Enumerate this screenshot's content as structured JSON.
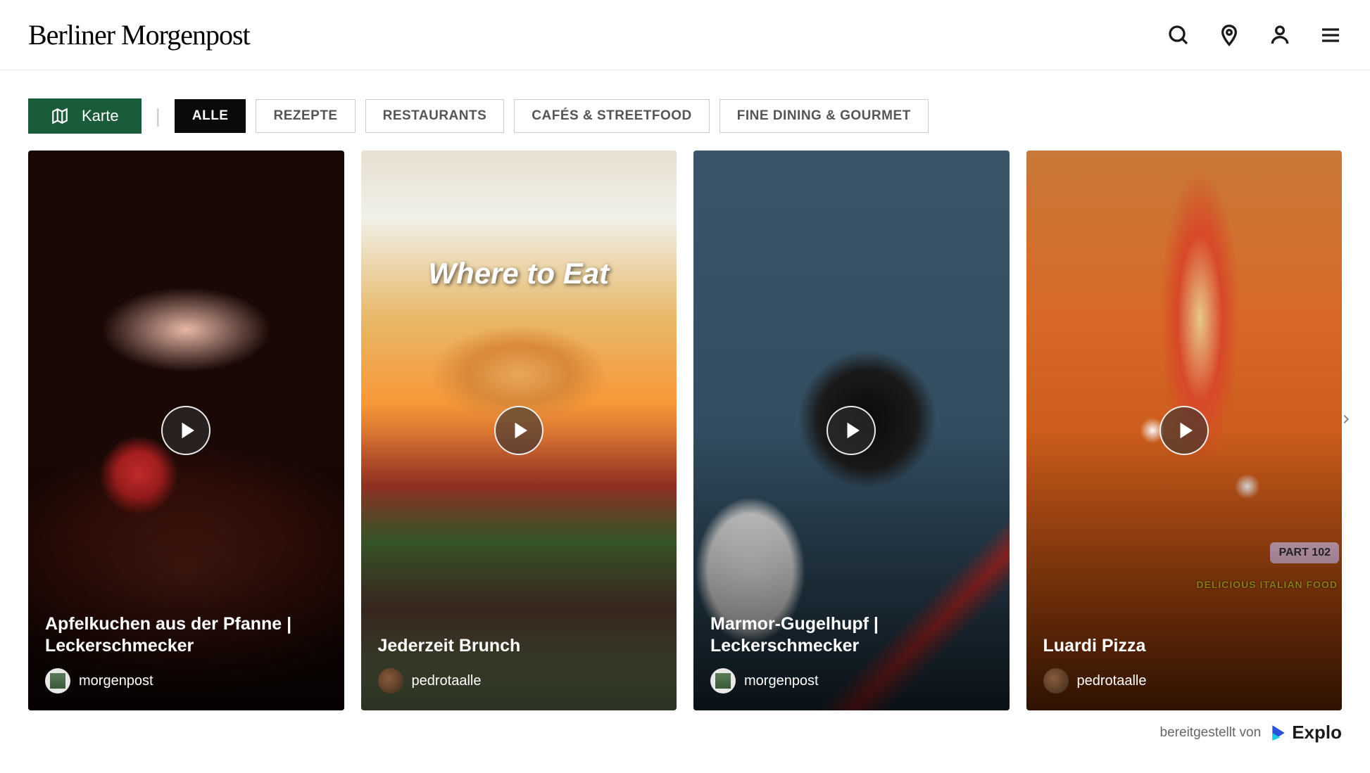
{
  "site": {
    "logo": "Berliner Morgenpost"
  },
  "filters": {
    "map_label": "Karte",
    "tabs": [
      {
        "label": "ALLE",
        "active": true
      },
      {
        "label": "REZEPTE",
        "active": false
      },
      {
        "label": "RESTAURANTS",
        "active": false
      },
      {
        "label": "CAFÉS & STREETFOOD",
        "active": false
      },
      {
        "label": "FINE DINING & GOURMET",
        "active": false
      }
    ]
  },
  "videos": [
    {
      "title": "Apfelkuchen aus der Pfanne | Leckerschmecker",
      "author": "morgenpost",
      "avatar_kind": "morgenpost",
      "bg_class": "bg-apple"
    },
    {
      "title": "Jederzeit Brunch",
      "author": "pedrotaalle",
      "avatar_kind": "pedrotaalle",
      "bg_class": "bg-brunch",
      "overlay_text": "Where to Eat"
    },
    {
      "title": "Marmor-Gugelhupf | Leckerschmecker",
      "author": "morgenpost",
      "avatar_kind": "morgenpost",
      "bg_class": "bg-cake"
    },
    {
      "title": "Luardi Pizza",
      "author": "pedrotaalle",
      "avatar_kind": "pedrotaalle",
      "bg_class": "bg-pizza",
      "part_badge": "PART 102",
      "delicious_text": "DELICIOUS ITALIAN FOOD"
    }
  ],
  "footer": {
    "credit_text": "bereitgestellt von",
    "brand": "Explo"
  }
}
